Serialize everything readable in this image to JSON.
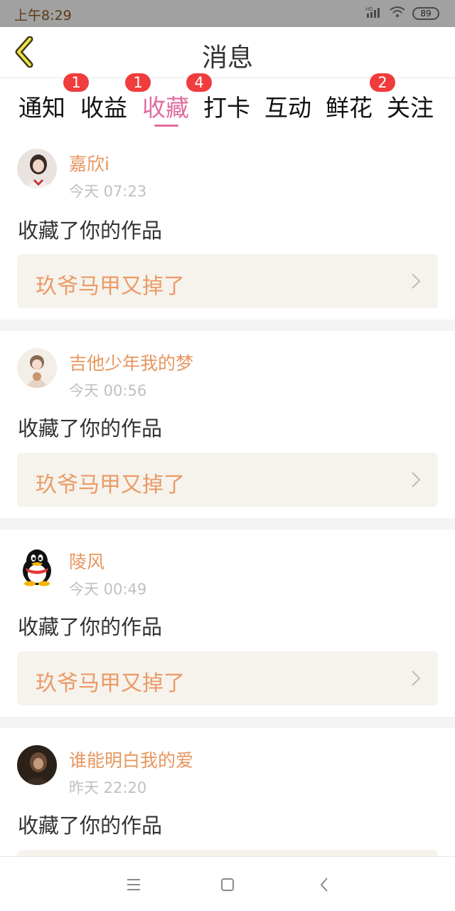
{
  "status_bar": {
    "time": "上午8:29",
    "battery": "89",
    "network": "HD"
  },
  "header": {
    "title": "消息"
  },
  "tabs": [
    {
      "label": "通知",
      "badge": null
    },
    {
      "label": "收益",
      "badge": "1"
    },
    {
      "label": "收藏",
      "badge": "1",
      "active": true
    },
    {
      "label": "打卡",
      "badge": "4"
    },
    {
      "label": "互动",
      "badge": null
    },
    {
      "label": "鲜花",
      "badge": null
    },
    {
      "label": "关注",
      "badge": "2"
    }
  ],
  "feed": [
    {
      "username": "嘉欣i",
      "time": "今天 07:23",
      "action": "收藏了你的作品",
      "work_title": "玖爷马甲又掉了"
    },
    {
      "username": "吉他少年我的梦",
      "time": "今天 00:56",
      "action": "收藏了你的作品",
      "work_title": "玖爷马甲又掉了"
    },
    {
      "username": "陵风",
      "time": "今天 00:49",
      "action": "收藏了你的作品",
      "work_title": "玖爷马甲又掉了"
    },
    {
      "username": "谁能明白我的爱",
      "time": "昨天 22:20",
      "action": "收藏了你的作品",
      "work_title": ""
    }
  ],
  "colors": {
    "accent_pink": "#e06ca0",
    "username_orange": "#e7965e",
    "badge_red": "#f03c3c",
    "work_box_bg": "#f5f3ec"
  },
  "nav": {
    "icons": [
      "menu-icon",
      "home-square-icon",
      "back-triangle-icon"
    ]
  }
}
